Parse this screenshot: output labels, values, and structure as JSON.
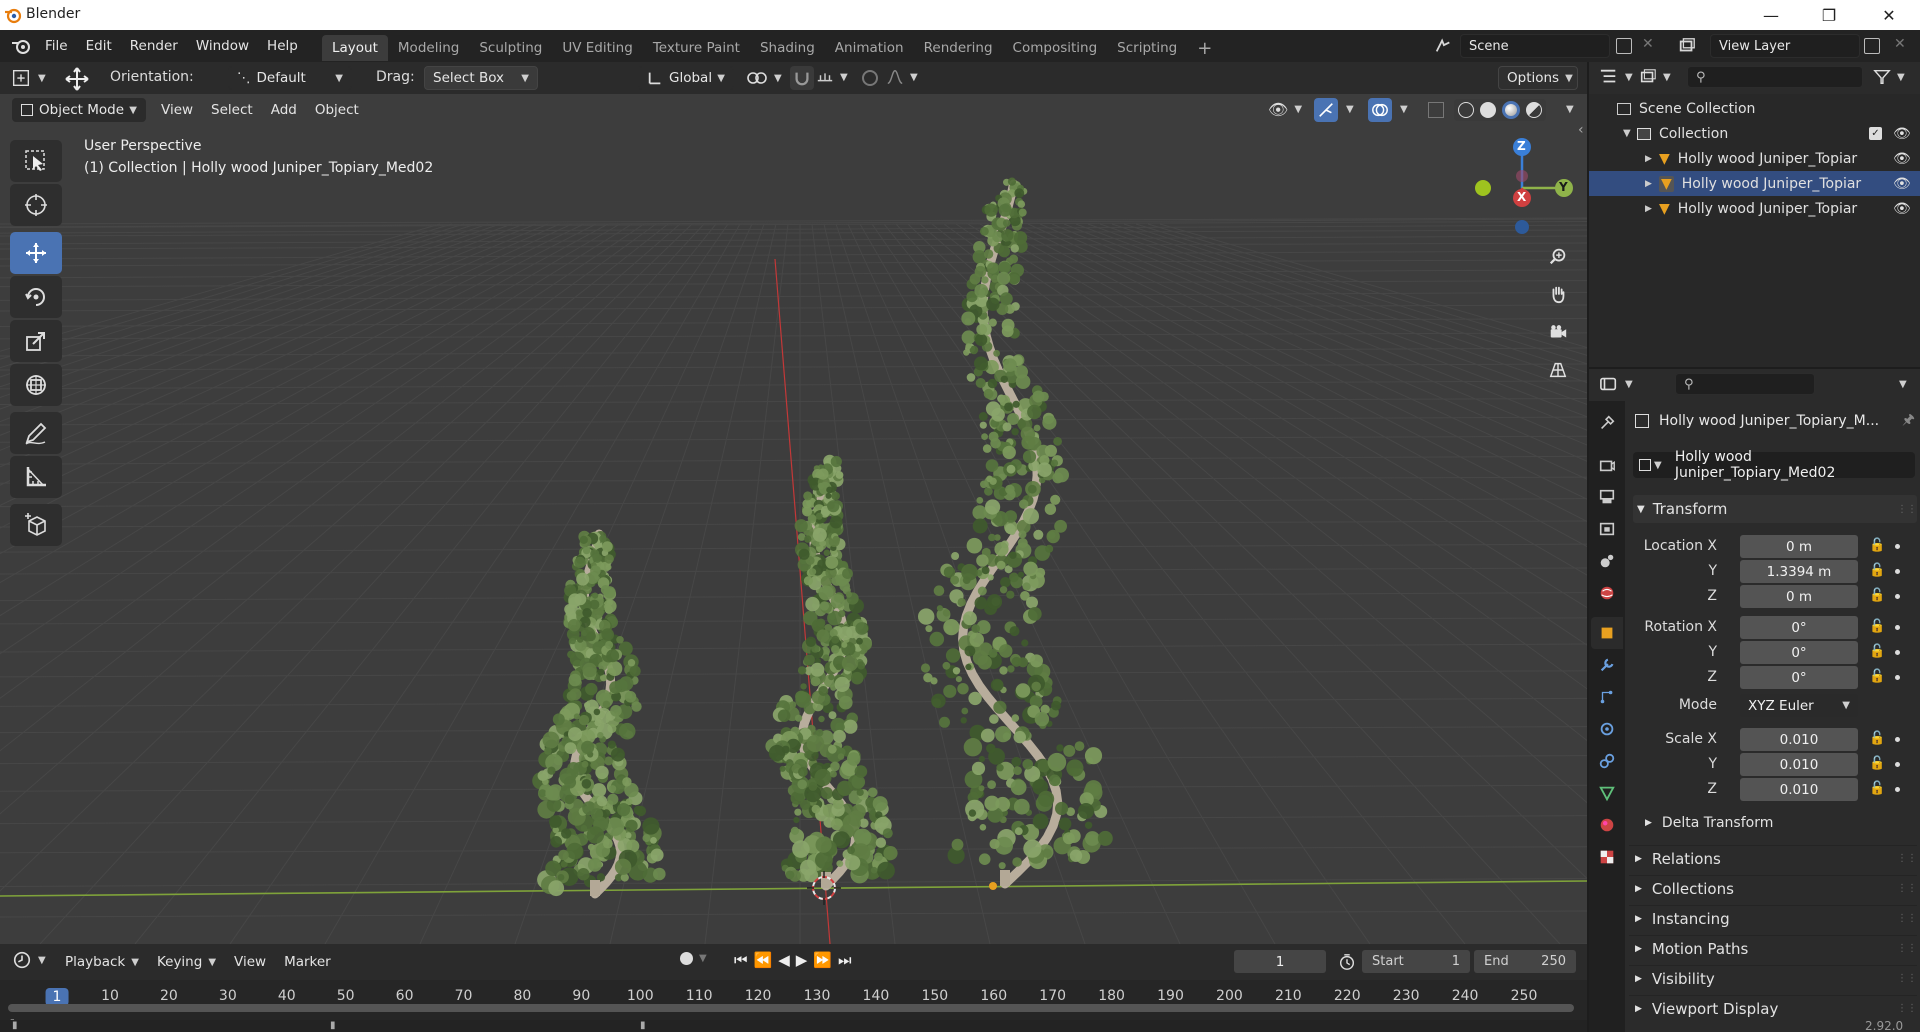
{
  "window": {
    "title": "Blender"
  },
  "menu": {
    "items": [
      "File",
      "Edit",
      "Render",
      "Window",
      "Help"
    ]
  },
  "workspaces": {
    "tabs": [
      "Layout",
      "Modeling",
      "Sculpting",
      "UV Editing",
      "Texture Paint",
      "Shading",
      "Animation",
      "Rendering",
      "Compositing",
      "Scripting"
    ],
    "active": "Layout",
    "add": "+"
  },
  "scene": {
    "name": "Scene"
  },
  "view_layer": {
    "name": "View Layer"
  },
  "tool_header": {
    "orientation_label": "Orientation:",
    "orientation_value": "Default",
    "drag_label": "Drag:",
    "drag_value": "Select Box",
    "transform_orientation": "Global",
    "options_label": "Options"
  },
  "view_header": {
    "mode": "Object Mode",
    "menus": [
      "View",
      "Select",
      "Add",
      "Object"
    ]
  },
  "viewport": {
    "perspective": "User Perspective",
    "collection_info": "(1) Collection | Holly wood Juniper_Topiary_Med02",
    "gizmo": {
      "z": "Z",
      "y": "Y",
      "x": "X"
    }
  },
  "timeline": {
    "menus": [
      "Playback",
      "Keying",
      "View",
      "Marker"
    ],
    "current_frame": "1",
    "start_label": "Start",
    "start_value": "1",
    "end_label": "End",
    "end_value": "250",
    "ruler": [
      "1",
      "10",
      "20",
      "30",
      "40",
      "50",
      "60",
      "70",
      "80",
      "90",
      "100",
      "110",
      "120",
      "130",
      "140",
      "150",
      "160",
      "170",
      "180",
      "190",
      "200",
      "210",
      "220",
      "230",
      "240",
      "250"
    ]
  },
  "outliner": {
    "root": "Scene Collection",
    "collection": "Collection",
    "objects": [
      "Holly wood Juniper_Topiar",
      "Holly wood Juniper_Topiar",
      "Holly wood Juniper_Topiar"
    ]
  },
  "properties": {
    "object_name_short": "Holly wood Juniper_Topiary_M...",
    "object_name": "Holly wood Juniper_Topiary_Med02",
    "transform_title": "Transform",
    "location_label": "Location X",
    "location": {
      "x": "0 m",
      "y": "1.3394 m",
      "z": "0 m"
    },
    "rotation_label": "Rotation X",
    "rotation": {
      "x": "0°",
      "y": "0°",
      "z": "0°"
    },
    "mode_label": "Mode",
    "mode_value": "XYZ Euler",
    "scale_label": "Scale X",
    "scale": {
      "x": "0.010",
      "y": "0.010",
      "z": "0.010"
    },
    "y_label": "Y",
    "z_label": "Z",
    "delta_transform": "Delta Transform",
    "panels": [
      "Relations",
      "Collections",
      "Instancing",
      "Motion Paths",
      "Visibility",
      "Viewport Display"
    ]
  },
  "status": {
    "version": "2.92.0"
  },
  "colors": {
    "accent": "#4a73b3",
    "viewport_bg": "#3d3d3d",
    "x_axis": "#d04040",
    "y_axis": "#8fb34a",
    "z_axis": "#3a7fd8"
  }
}
